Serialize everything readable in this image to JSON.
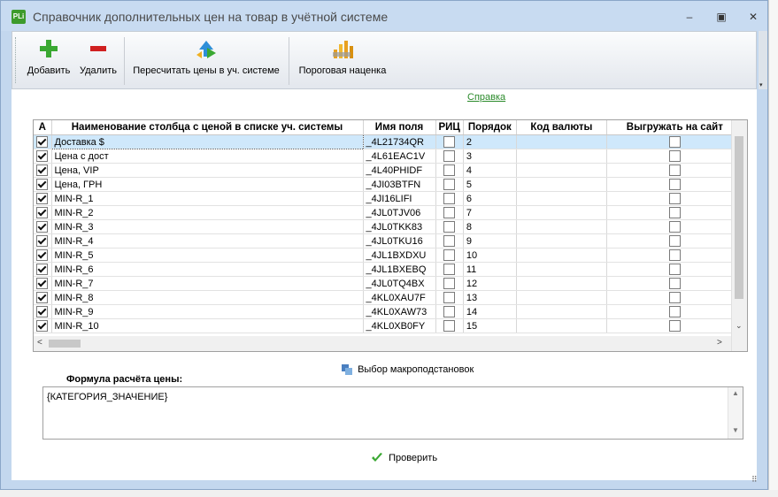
{
  "window": {
    "app_icon_text": "PLi",
    "title": "Справочник дополнительных цен на товар в учётной системе",
    "controls": {
      "minimize": "–",
      "maximize": "▣",
      "close": "✕"
    }
  },
  "toolbar": {
    "add_label": "Добавить",
    "delete_label": "Удалить",
    "recalc_label": "Пересчитать цены в уч. системе",
    "threshold_label": "Пороговая наценка",
    "scroll_icon": "▾"
  },
  "help_link": "Справка",
  "table": {
    "headers": {
      "active": "A",
      "name": "Наименование столбца с ценой в списке уч. системы",
      "field": "Имя поля",
      "ric": "РИЦ",
      "order": "Порядок",
      "currency": "Код валюты",
      "export": "Выгружать на сайт"
    },
    "rows": [
      {
        "active": true,
        "name": "Доставка $",
        "field": "_4L21734QR",
        "ric": false,
        "order": "2",
        "currency": "",
        "export": false,
        "selected": true
      },
      {
        "active": true,
        "name": "Цена с дост",
        "field": "_4L61EAC1V",
        "ric": false,
        "order": "3",
        "currency": "",
        "export": false
      },
      {
        "active": true,
        "name": "Цена, VIP",
        "field": "_4L40PHIDF",
        "ric": false,
        "order": "4",
        "currency": "",
        "export": false
      },
      {
        "active": true,
        "name": "Цена, ГРН",
        "field": "_4JI03BTFN",
        "ric": false,
        "order": "5",
        "currency": "",
        "export": false
      },
      {
        "active": true,
        "name": "MIN-R_1",
        "field": "_4JI16LIFI",
        "ric": false,
        "order": "6",
        "currency": "",
        "export": false
      },
      {
        "active": true,
        "name": "MIN-R_2",
        "field": "_4JL0TJV06",
        "ric": false,
        "order": "7",
        "currency": "",
        "export": false
      },
      {
        "active": true,
        "name": "MIN-R_3",
        "field": "_4JL0TKK83",
        "ric": false,
        "order": "8",
        "currency": "",
        "export": false
      },
      {
        "active": true,
        "name": "MIN-R_4",
        "field": "_4JL0TKU16",
        "ric": false,
        "order": "9",
        "currency": "",
        "export": false
      },
      {
        "active": true,
        "name": "MIN-R_5",
        "field": "_4JL1BXDXU",
        "ric": false,
        "order": "10",
        "currency": "",
        "export": false
      },
      {
        "active": true,
        "name": "MIN-R_6",
        "field": "_4JL1BXEBQ",
        "ric": false,
        "order": "11",
        "currency": "",
        "export": false
      },
      {
        "active": true,
        "name": "MIN-R_7",
        "field": "_4JL0TQ4BX",
        "ric": false,
        "order": "12",
        "currency": "",
        "export": false
      },
      {
        "active": true,
        "name": "MIN-R_8",
        "field": "_4KL0XAU7F",
        "ric": false,
        "order": "13",
        "currency": "",
        "export": false
      },
      {
        "active": true,
        "name": "MIN-R_9",
        "field": "_4KL0XAW73",
        "ric": false,
        "order": "14",
        "currency": "",
        "export": false
      },
      {
        "active": true,
        "name": "MIN-R_10",
        "field": "_4KL0XB0FY",
        "ric": false,
        "order": "15",
        "currency": "",
        "export": false
      }
    ],
    "scroll_arrows": {
      "up": "▲",
      "down": "⌄",
      "left": "<",
      "right": ">"
    }
  },
  "macro_button": "Выбор макроподстановок",
  "formula": {
    "label": "Формула расчёта цены:",
    "value": "{КАТЕГОРИЯ_ЗНАЧЕНИЕ}"
  },
  "check_button": "Проверить",
  "colors": {
    "accent": "#2a8a2a",
    "title_bg": "#c8dbf1",
    "selected_row": "#cfe8fb",
    "add_icon": "#3aa832",
    "delete_icon": "#d02020"
  },
  "icons": {
    "add": "plus-icon",
    "delete": "minus-icon",
    "recalc": "recalc-arrows-icon",
    "threshold": "bar-chart-icon",
    "macro": "macro-icon",
    "check": "checkmark-icon"
  }
}
